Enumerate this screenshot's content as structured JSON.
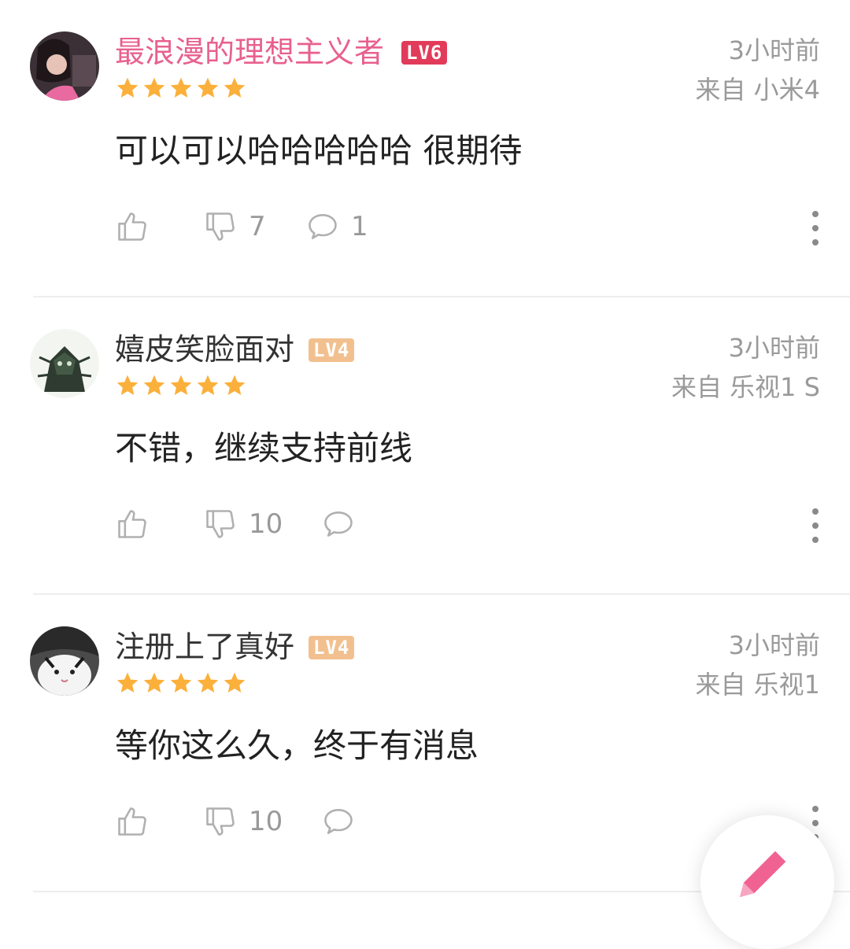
{
  "colors": {
    "username_vip": "#e8608e",
    "username": "#333333",
    "lv6_badge": "#e23b5a",
    "lv4_badge": "#f2c08f",
    "star": "#fbb03b",
    "meta_text": "#9a9a9a",
    "icon": "#b0b0b0",
    "fab_pencil": "#f06292"
  },
  "comments": [
    {
      "username": "最浪漫的理想主义者",
      "level": "LV6",
      "rating": 5,
      "time": "3小时前",
      "device": "来自 小米4",
      "content": "可以可以哈哈哈哈哈 很期待",
      "dislikes": "7",
      "replies": "1"
    },
    {
      "username": "嬉皮笑脸面对",
      "level": "LV4",
      "rating": 5,
      "time": "3小时前",
      "device": "来自 乐视1 S",
      "content": "不错，继续支持前线",
      "dislikes": "10",
      "replies": ""
    },
    {
      "username": "注册上了真好",
      "level": "LV4",
      "rating": 5,
      "time": "3小时前",
      "device": "来自 乐视1",
      "content": "等你这么久，终于有消息",
      "dislikes": "10",
      "replies": ""
    }
  ],
  "icons": {
    "like": "thumbs-up-icon",
    "dislike": "thumbs-down-icon",
    "reply": "speech-bubble-icon",
    "more": "more-vertical-icon",
    "compose": "pencil-icon"
  }
}
